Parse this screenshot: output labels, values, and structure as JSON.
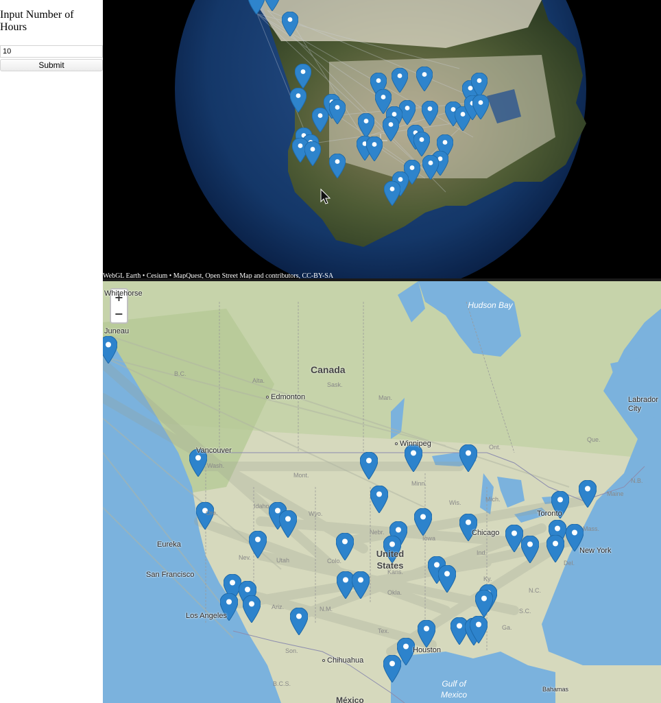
{
  "panel": {
    "label": "Input Number of Hours",
    "hours_value": "10",
    "submit_label": "Submit"
  },
  "globe": {
    "credit": "WebGL Earth • Cesium • MapQuest, Open Street Map and contributors, CC-BY-SA",
    "marker_color": "#2e84cc"
  },
  "map": {
    "zoom_in": "+",
    "zoom_out": "−",
    "labels": {
      "whitehorse": "Whitehorse",
      "juneau": "Juneau",
      "canada": "Canada",
      "edmonton": "Edmonton",
      "vancouver": "Vancouver",
      "winnipeg": "Winnipeg",
      "hudson_bay": "Hudson Bay",
      "labrador_city": "Labrador City",
      "toronto": "Toronto",
      "chicago": "Chicago",
      "new_york": "New York",
      "eureka": "Eureka",
      "san_francisco": "San Francisco",
      "los_angeles": "Los Angeles",
      "united_states": "United States",
      "houston": "Houston",
      "chihuahua": "Chihuahua",
      "gulf_of_mexico": "Gulf of Mexico",
      "bahamas": "Bahamas",
      "mexico": "México"
    },
    "province_labels": [
      "B.C.",
      "Alta.",
      "Sask.",
      "Man.",
      "Ont.",
      "Que.",
      "N.B.",
      "Maine",
      "Wash.",
      "Ore.",
      "Idaho",
      "Mont.",
      "Wyo.",
      "Nev.",
      "Utah",
      "Colo.",
      "Nebr.",
      "Kans.",
      "Okla.",
      "Tex.",
      "N.M.",
      "Ariz.",
      "Minn.",
      "Wis.",
      "Mich.",
      "Iowa",
      "Ind.",
      "Ky.",
      "N.C.",
      "S.C.",
      "Ga.",
      "Mass.",
      "Del.",
      "Son.",
      "B.C.S."
    ],
    "marker_count_visible": 44
  }
}
